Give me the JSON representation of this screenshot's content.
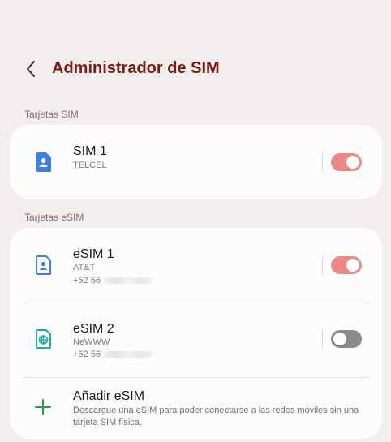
{
  "header": {
    "title": "Administrador de SIM"
  },
  "sections": {
    "sim_label": "Tarjetas SIM",
    "esim_label": "Tarjetas eSIM"
  },
  "sim1": {
    "title": "SIM 1",
    "carrier": "TELCEL",
    "enabled": true
  },
  "esim1": {
    "title": "eSIM 1",
    "carrier": "AT&T",
    "number_prefix": "+52 56",
    "enabled": true
  },
  "esim2": {
    "title": "eSIM 2",
    "carrier": "NeWWW",
    "number_prefix": "+52 56",
    "enabled": false
  },
  "add_esim": {
    "title": "Añadir eSIM",
    "description": "Descargue una eSIM para poder conectarse a las redes móviles sin una tarjeta SIM física."
  },
  "colors": {
    "title": "#7a1b14",
    "toggle_on": "#ea8a83",
    "toggle_off": "#8a8a8d",
    "sim_icon": "#3f7fe0",
    "esim2_icon": "#29a3a8",
    "plus_icon": "#1e9b4f"
  },
  "icons": {
    "back": "chevron-left-icon",
    "sim": "sim-card-icon",
    "esim": "esim-card-icon",
    "esim_globe": "esim-globe-icon",
    "add": "plus-icon"
  }
}
